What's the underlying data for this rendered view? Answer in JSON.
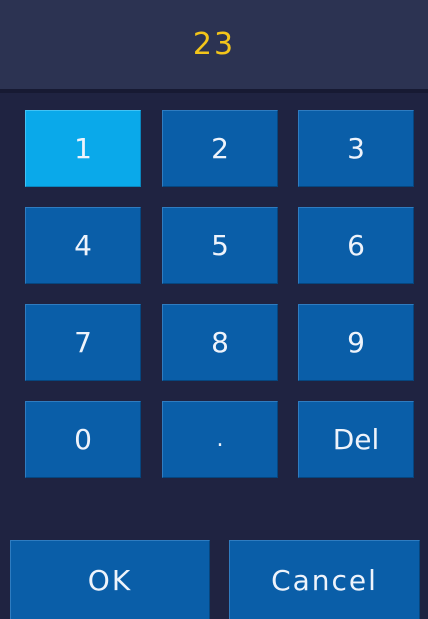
{
  "display": {
    "value": "23"
  },
  "keypad": {
    "keys": [
      "1",
      "2",
      "3",
      "4",
      "5",
      "6",
      "7",
      "8",
      "9",
      "0",
      ".",
      "Del"
    ],
    "highlighted_key": "1"
  },
  "actions": {
    "ok_label": "OK",
    "cancel_label": "Cancel"
  },
  "colors": {
    "background": "#1f2341",
    "display_background": "#2c3352",
    "display_text": "#f3c51a",
    "key": "#0a5ea8",
    "key_highlighted": "#0aa9ea",
    "key_text": "#eef3fb"
  }
}
